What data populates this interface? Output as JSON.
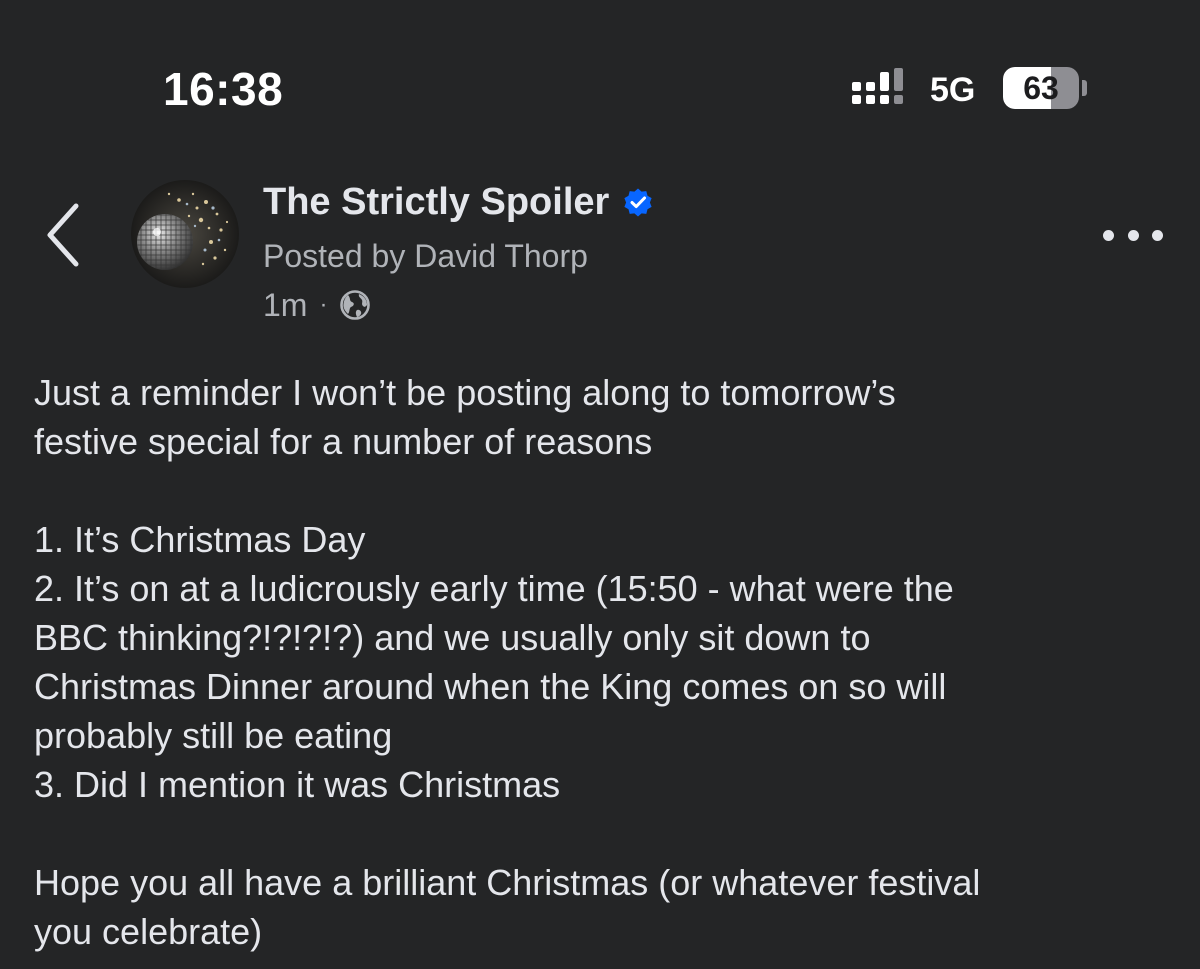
{
  "status_bar": {
    "time": "16:38",
    "network": "5G",
    "battery_level": "63",
    "battery_percent": 63,
    "signal_icon": "cellular-signal-icon"
  },
  "post": {
    "page_name": "The Strictly Spoiler",
    "verified": true,
    "posted_by": "Posted by David Thorp",
    "time_ago": "1m",
    "separator": "·",
    "audience_icon": "globe-icon",
    "body": {
      "intro": [
        "Just a reminder I won’t be posting along to tomorrow’s",
        "festive special for a number of reasons"
      ],
      "list": [
        "1. It’s Christmas Day",
        "2. It’s on at a ludicrously early time (15:50 - what were the",
        "BBC thinking?!?!?!?) and we usually only sit down to",
        "Christmas Dinner around when the King comes on so will",
        "probably still be eating",
        "3. Did I mention it was Christmas"
      ],
      "outro": [
        "Hope you all have a brilliant Christmas (or whatever festival",
        "you celebrate)"
      ]
    }
  },
  "icons": {
    "back": "chevron-left-icon",
    "more": "more-horizontal-icon",
    "verified": "verified-badge-icon"
  },
  "colors": {
    "background": "#242526",
    "primary_text": "#e4e6eb",
    "secondary_text": "#b0b3b8",
    "verified_blue": "#0866ff"
  }
}
